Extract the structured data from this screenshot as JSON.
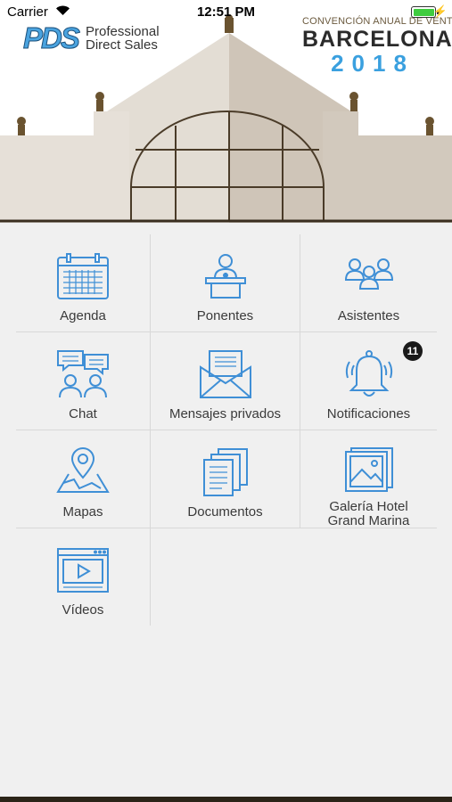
{
  "status_bar": {
    "carrier": "Carrier",
    "time": "12:51 PM",
    "battery_level": 1.0
  },
  "header": {
    "logo_mark": "PDS",
    "logo_line1": "Professional",
    "logo_line2": "Direct Sales",
    "event_subtitle": "CONVENCIÓN ANUAL DE VENTAS",
    "event_city": "BARCELONA",
    "event_year": "2018"
  },
  "menu": [
    {
      "label": "Agenda",
      "icon": "calendar-icon"
    },
    {
      "label": "Ponentes",
      "icon": "speaker-podium-icon"
    },
    {
      "label": "Asistentes",
      "icon": "attendees-icon"
    },
    {
      "label": "Chat",
      "icon": "chat-icon"
    },
    {
      "label": "Mensajes privados",
      "icon": "envelope-icon"
    },
    {
      "label": "Notificaciones",
      "icon": "bell-icon",
      "badge": "11"
    },
    {
      "label": "Mapas",
      "icon": "map-pin-icon"
    },
    {
      "label": "Documentos",
      "icon": "documents-icon"
    },
    {
      "label": "Galería Hotel",
      "label2": "Grand Marina",
      "icon": "gallery-icon"
    },
    {
      "label": "Vídeos",
      "icon": "video-player-icon"
    }
  ],
  "colors": {
    "icon_blue": "#3f8fd6",
    "accent_blue": "#3aa0df",
    "building": "#ddd6cc",
    "building_shade": "#c9bfb2",
    "dark_brown": "#4a3b28"
  }
}
